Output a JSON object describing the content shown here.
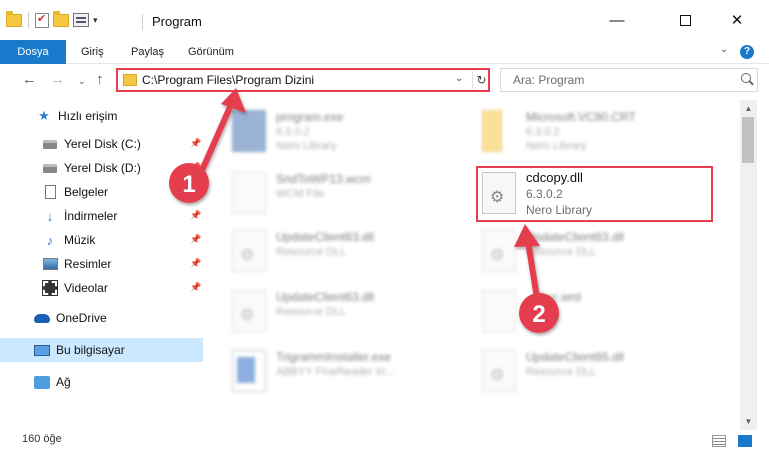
{
  "window": {
    "title": "Program",
    "minimize_glyph": "—",
    "close_glyph": "✕"
  },
  "ribbon": {
    "tabs": [
      "Dosya",
      "Giriş",
      "Paylaş",
      "Görünüm"
    ],
    "collapse_glyph": "⌄",
    "help_glyph": "?"
  },
  "nav": {
    "back_glyph": "←",
    "forward_glyph": "→",
    "recent_glyph": "⌄",
    "up_glyph": "↑",
    "address": "C:\\Program Files\\Program Dizini",
    "address_drop_glyph": "⌄",
    "refresh_glyph": "↻",
    "search_placeholder": "Ara: Program"
  },
  "sidebar": {
    "items": [
      {
        "label": "Hızlı erişim",
        "icon": "star-icon"
      },
      {
        "label": "Yerel Disk (C:)",
        "icon": "disk-icon",
        "pinned": true
      },
      {
        "label": "Yerel Disk (D:)",
        "icon": "disk-icon",
        "pinned": true
      },
      {
        "label": "Belgeler",
        "icon": "document-icon",
        "pinned": true
      },
      {
        "label": "İndirmeler",
        "icon": "download-icon",
        "pinned": true
      },
      {
        "label": "Müzik",
        "icon": "music-icon",
        "pinned": true
      },
      {
        "label": "Resimler",
        "icon": "pictures-icon",
        "pinned": true
      },
      {
        "label": "Videolar",
        "icon": "videos-icon",
        "pinned": true
      },
      {
        "label": "OneDrive",
        "icon": "cloud-icon"
      },
      {
        "label": "Bu bilgisayar",
        "icon": "computer-icon",
        "selected": true
      },
      {
        "label": "Ağ",
        "icon": "network-icon"
      }
    ],
    "pin_glyph": "📌"
  },
  "files": [
    {
      "name": "program.exe",
      "line2": "6.3.0.2",
      "line3": "Nero Library"
    },
    {
      "name": "Microsoft.VC90.CRT",
      "line2": "6.3.0.2",
      "line3": "Nero Library"
    },
    {
      "name": "SndToWP13.wcm",
      "line2": "WCM File",
      "line3": ""
    },
    {
      "name": "UpdateClient63.dll",
      "line2": "Resource DLL",
      "line3": ""
    },
    {
      "name": "UpdateClient63.dll",
      "line2": "Resource DLL",
      "line3": ""
    },
    {
      "name": "UpdateClient63.dll",
      "line2": "Resource DLL",
      "line3": ""
    },
    {
      "name": "...dlac.wrd",
      "line2": "...File",
      "line3": ""
    },
    {
      "name": "TrigrammInstaller.exe",
      "line2": "ABBYY FineReader tri...",
      "line3": ""
    },
    {
      "name": "UpdateClient65.dll",
      "line2": "Resource DLL",
      "line3": ""
    }
  ],
  "highlighted_file": {
    "name": "cdcopy.dll",
    "version": "6.3.0.2",
    "description": "Nero Library"
  },
  "annotations": {
    "step1": "1",
    "step2": "2",
    "color": "#e43d4d"
  },
  "scrollbar": {
    "up_glyph": "▲",
    "down_glyph": "▼"
  },
  "status": {
    "item_count": "160 öğe"
  }
}
